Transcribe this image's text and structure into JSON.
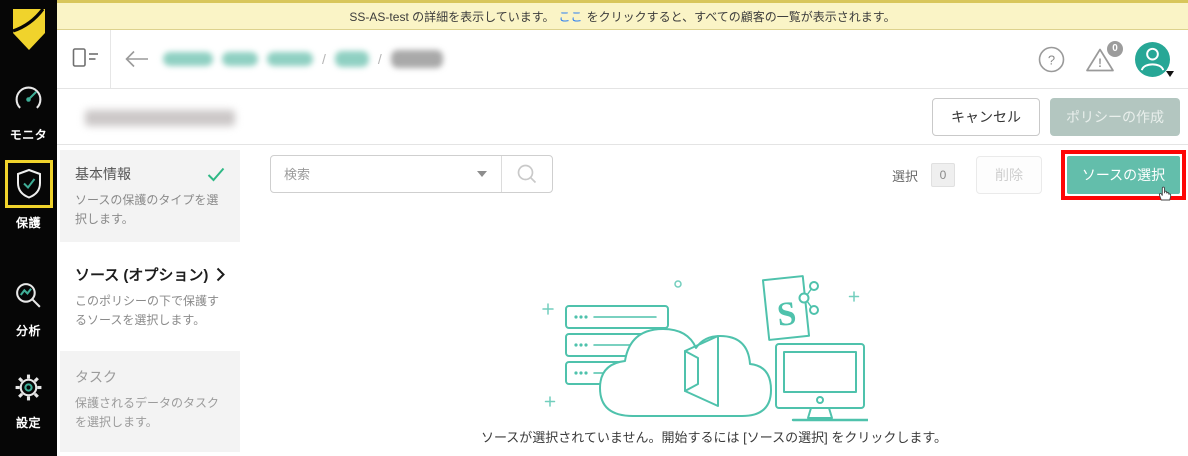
{
  "colors": {
    "accent_teal": "#63beab",
    "illustration_teal": "#4fc2ac",
    "logo_yellow": "#f0d32c",
    "banner_bg": "#faf4c6",
    "banner_link_blue": "#2d7ff0",
    "sidebar_bg": "#060606",
    "avatar_teal": "#27a796",
    "check_green": "#2eb885",
    "annotation_red": "#fe0505",
    "disabled_button_bg": "#b3c6c0"
  },
  "banner": {
    "text_before_link": "SS-AS-test の詳細を表示しています。",
    "link_text": "ここ",
    "text_after_link": "をクリックすると、すべての顧客の一覧が表示されます。"
  },
  "sidebar": {
    "items": [
      {
        "label": "モニタ",
        "icon": "gauge-icon",
        "active": false
      },
      {
        "label": "保護",
        "icon": "shield-check-icon",
        "active": true
      },
      {
        "label": "分析",
        "icon": "magnifier-chart-icon",
        "active": false
      },
      {
        "label": "設定",
        "icon": "gear-icon",
        "active": false
      }
    ]
  },
  "header": {
    "help_glyph": "?",
    "alert_glyph": "!",
    "alert_badge_count": "0"
  },
  "breadcrumb": {
    "separator": "/"
  },
  "page_actions": {
    "cancel_label": "キャンセル",
    "create_policy_label": "ポリシーの作成"
  },
  "steps": [
    {
      "title": "基本情報",
      "description": "ソースの保護のタイプを選択します。",
      "status": "complete"
    },
    {
      "title": "ソース (オプション)",
      "description": "このポリシーの下で保護するソースを選択します。",
      "status": "active"
    },
    {
      "title": "タスク",
      "description": "保護されるデータのタスクを選択します。",
      "status": "pending"
    }
  ],
  "toolbar": {
    "search_placeholder": "検索"
  },
  "selection": {
    "selected_label": "選択",
    "selected_count": "0",
    "delete_label": "削除",
    "select_source_label": "ソースの選択"
  },
  "empty_state": {
    "message": "ソースが選択されていません。開始するには [ソースの選択] をクリックします。"
  },
  "illustration": {
    "sharepoint_letter": "S"
  }
}
